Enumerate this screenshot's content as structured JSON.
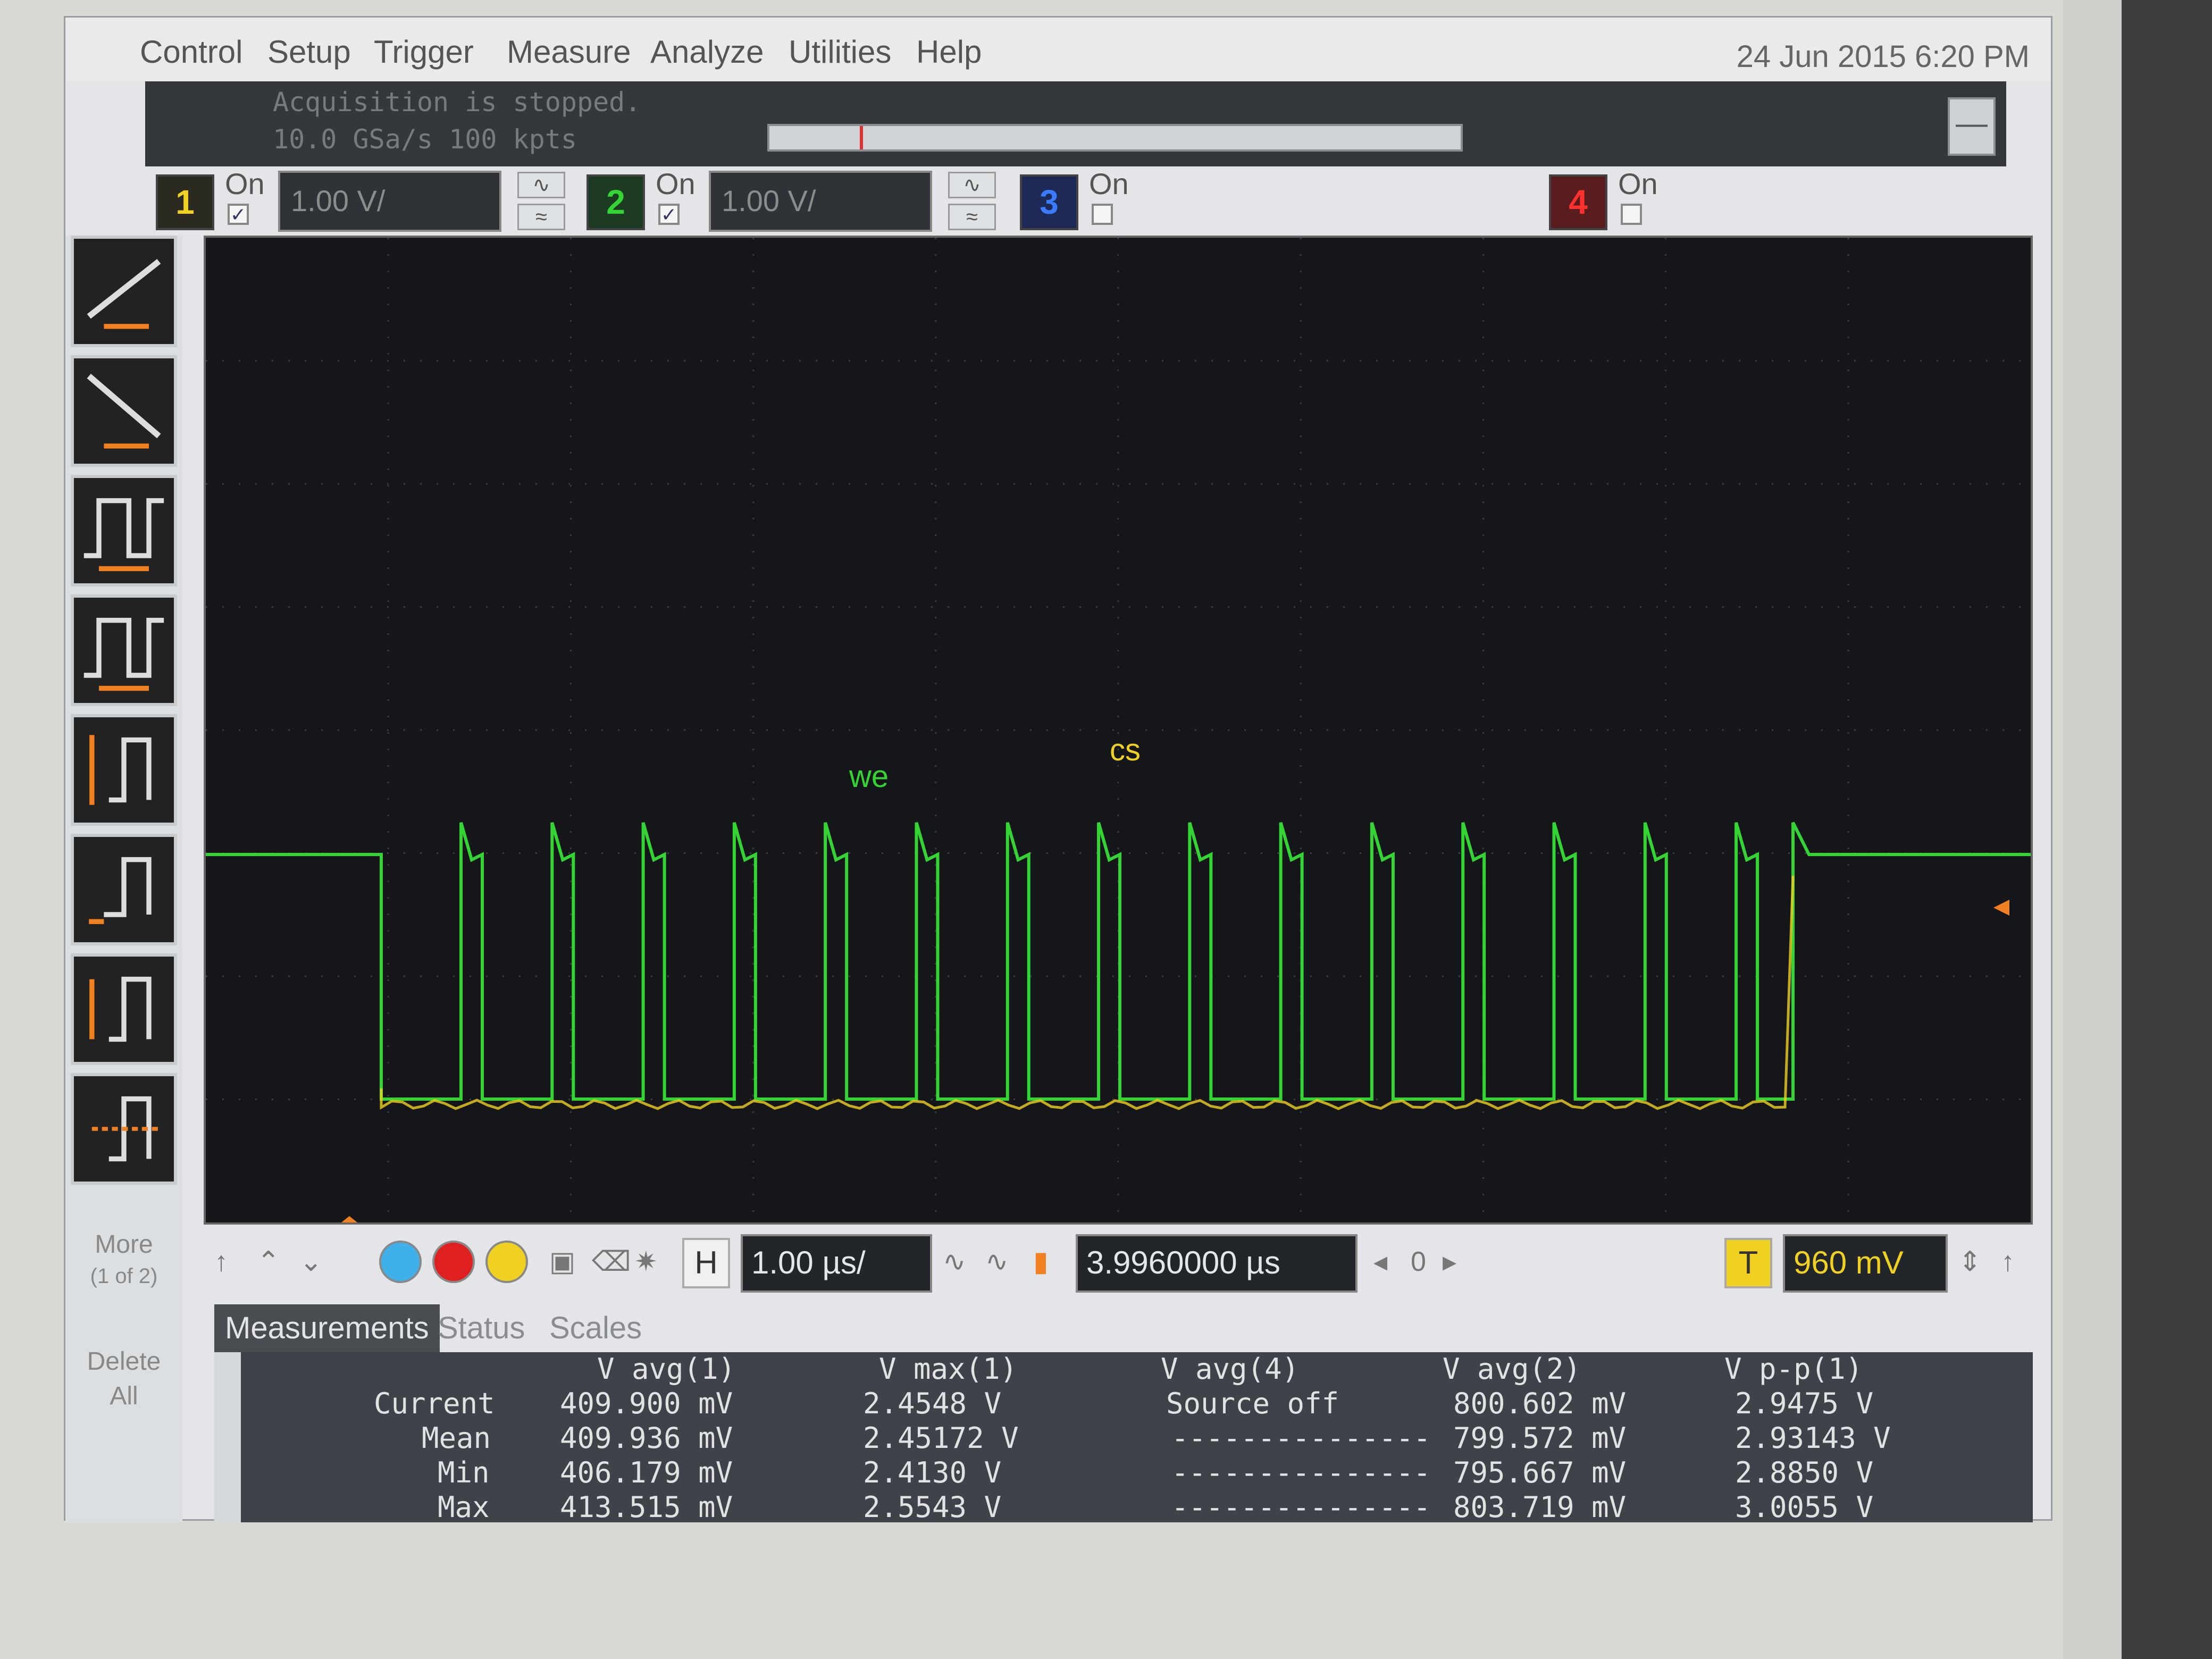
{
  "menu": [
    "Control",
    "Setup",
    "Trigger",
    "Measure",
    "Analyze",
    "Utilities",
    "Help"
  ],
  "datetime": "24 Jun 2015  6:20 PM",
  "status": {
    "line1": "Acquisition is stopped.",
    "line2": "10.0 GSa/s   100 kpts"
  },
  "minimize_label": "—",
  "channels": [
    {
      "num": "1",
      "on_label": "On",
      "checked": true,
      "scale": "1.00 V/",
      "color": "#f0d020"
    },
    {
      "num": "2",
      "on_label": "On",
      "checked": true,
      "scale": "1.00 V/",
      "color": "#35d435"
    },
    {
      "num": "3",
      "on_label": "On",
      "checked": false,
      "scale": "",
      "color": "#3a7cff"
    },
    {
      "num": "4",
      "on_label": "On",
      "checked": false,
      "scale": "",
      "color": "#ff3030"
    }
  ],
  "coupling_symbols": {
    "dc": "∿",
    "ac": "≈"
  },
  "side": {
    "more_line1": "More",
    "more_line2": "(1 of 2)",
    "delete_line1": "Delete",
    "delete_line2": "All"
  },
  "waveform_labels": {
    "we": "we",
    "cs": "cs"
  },
  "timebase": {
    "h_label": "H",
    "scale": "1.00 µs/",
    "delay": "3.9960000 µs",
    "nav_value": "0",
    "trigger_label": "T",
    "trigger_level": "960 mV"
  },
  "tabs": [
    "Measurements",
    "Status",
    "Scales"
  ],
  "measurements": {
    "headers": [
      "V avg(1)",
      "V max(1)",
      "V avg(4)",
      "V avg(2)",
      "V p-p(1)"
    ],
    "rows": [
      {
        "label": "Current",
        "values": [
          "409.900 mV",
          "2.4548 V",
          "Source off",
          "800.602 mV",
          "2.9475 V"
        ]
      },
      {
        "label": "Mean",
        "values": [
          "409.936 mV",
          "2.45172 V",
          "---------------",
          "799.572 mV",
          "2.93143 V"
        ]
      },
      {
        "label": "Min",
        "values": [
          "406.179 mV",
          "2.4130 V",
          "---------------",
          "795.667 mV",
          "2.8850 V"
        ]
      },
      {
        "label": "Max",
        "values": [
          "413.515 mV",
          "2.5543 V",
          "---------------",
          "803.719 mV",
          "3.0055 V"
        ]
      }
    ]
  },
  "colors": {
    "ch1": "#f0d020",
    "ch2": "#35d435",
    "ch3": "#3a7cff",
    "ch4": "#ff3030"
  }
}
